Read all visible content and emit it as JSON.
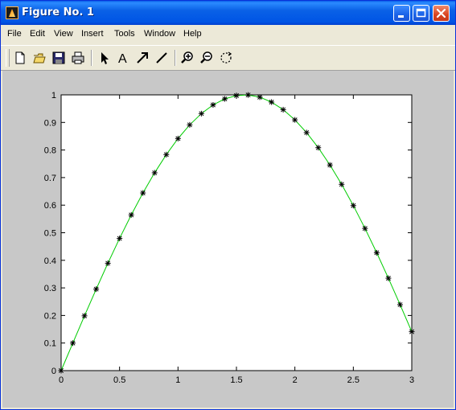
{
  "window": {
    "title": "Figure No. 1"
  },
  "menu": [
    "File",
    "Edit",
    "View",
    "Insert",
    "Tools",
    "Window",
    "Help"
  ],
  "toolbar": {
    "tools": [
      "new-figure-icon",
      "open-file-icon",
      "save-icon",
      "print-icon",
      "select-arrow-icon",
      "insert-text-icon",
      "insert-arrow-icon",
      "insert-line-icon",
      "zoom-in-icon",
      "zoom-out-icon",
      "rotate-3d-icon"
    ]
  },
  "chart_data": {
    "type": "line",
    "title": "",
    "xlabel": "",
    "ylabel": "",
    "xlim": [
      0,
      3
    ],
    "ylim": [
      0,
      1
    ],
    "x_ticks": [
      "0",
      "0.5",
      "1",
      "1.5",
      "2",
      "2.5",
      "3"
    ],
    "y_ticks": [
      "0",
      "0.1",
      "0.2",
      "0.3",
      "0.4",
      "0.5",
      "0.6",
      "0.7",
      "0.8",
      "0.9",
      "1"
    ],
    "grid": false,
    "series": [
      {
        "style": "line",
        "color": "#00cc00",
        "x": [
          0,
          0.1,
          0.2,
          0.3,
          0.4,
          0.5,
          0.6,
          0.7,
          0.8,
          0.9,
          1.0,
          1.1,
          1.2,
          1.3,
          1.4,
          1.5,
          1.6,
          1.7,
          1.8,
          1.9,
          2.0,
          2.1,
          2.2,
          2.3,
          2.4,
          2.5,
          2.6,
          2.7,
          2.8,
          2.9,
          3.0
        ],
        "y": [
          0,
          0.0998,
          0.1987,
          0.2955,
          0.3894,
          0.4794,
          0.5646,
          0.6442,
          0.7174,
          0.7833,
          0.8415,
          0.8912,
          0.932,
          0.9636,
          0.9854,
          0.9975,
          0.9996,
          0.9917,
          0.9738,
          0.9463,
          0.9093,
          0.8632,
          0.8085,
          0.7457,
          0.6755,
          0.5985,
          0.5155,
          0.4274,
          0.335,
          0.2392,
          0.1411
        ]
      },
      {
        "style": "marker-asterisk",
        "color": "#000000",
        "x": [
          0,
          0.1,
          0.2,
          0.3,
          0.4,
          0.5,
          0.6,
          0.7,
          0.8,
          0.9,
          1.0,
          1.1,
          1.2,
          1.3,
          1.4,
          1.5,
          1.6,
          1.7,
          1.8,
          1.9,
          2.0,
          2.1,
          2.2,
          2.3,
          2.4,
          2.5,
          2.6,
          2.7,
          2.8,
          2.9,
          3.0
        ],
        "y": [
          0,
          0.0998,
          0.1987,
          0.2955,
          0.3894,
          0.4794,
          0.5646,
          0.6442,
          0.7174,
          0.7833,
          0.8415,
          0.8912,
          0.932,
          0.9636,
          0.9854,
          0.9975,
          0.9996,
          0.9917,
          0.9738,
          0.9463,
          0.9093,
          0.8632,
          0.8085,
          0.7457,
          0.6755,
          0.5985,
          0.5155,
          0.4274,
          0.335,
          0.2392,
          0.1411
        ]
      }
    ]
  }
}
